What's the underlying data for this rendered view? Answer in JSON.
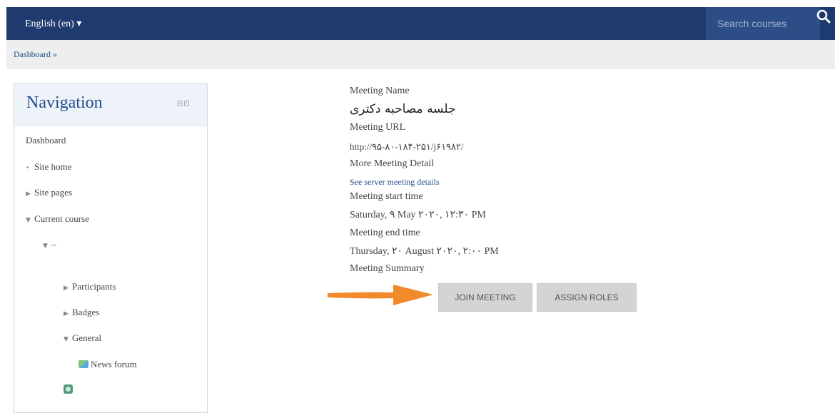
{
  "navbar": {
    "language": "English (en) ▾",
    "search_placeholder": "Search courses",
    "search_icon": "search-icon",
    "colors": {
      "bar": "#1e3a6e",
      "search_bg": "#2c4d86"
    }
  },
  "breadcrumb": {
    "text": "Dashboard »"
  },
  "navigation": {
    "title": "Navigation",
    "dock_icons": "⊟⊡",
    "items": [
      {
        "mark": "",
        "label": "Dashboard"
      },
      {
        "mark": "•",
        "label": "Site home"
      },
      {
        "mark": "▶",
        "label": "Site pages"
      },
      {
        "mark": "▼",
        "label": "Current course"
      },
      {
        "mark": "▼",
        "label": "–"
      },
      {
        "mark": "▶",
        "label": "Participants"
      },
      {
        "mark": "▶",
        "label": "Badges"
      },
      {
        "mark": "▼",
        "label": "General"
      },
      {
        "mark": "",
        "label": "News forum"
      }
    ]
  },
  "meeting": {
    "name_label": "Meeting Name",
    "name_value": "جلسه مصاحبه دکتری",
    "url_label": "Meeting URL",
    "url_value": "http://۹۵-۸۰-۱۸۴-۲۵۱/j۶۱۹۸۲/",
    "detail_label": "More Meeting Detail",
    "detail_link": "See server meeting details",
    "start_label": "Meeting start time",
    "start_value": "Saturday, ۹ May ۲۰۲۰, ۱۲:۳۰ PM",
    "end_label": "Meeting end time",
    "end_value": "Thursday, ۲۰ August ۲۰۲۰, ۲:۰۰ PM",
    "summary_label": "Meeting Summary",
    "join_button": "JOIN MEETING",
    "assign_button": "ASSIGN ROLES",
    "arrow_color": "#f08a2a"
  }
}
